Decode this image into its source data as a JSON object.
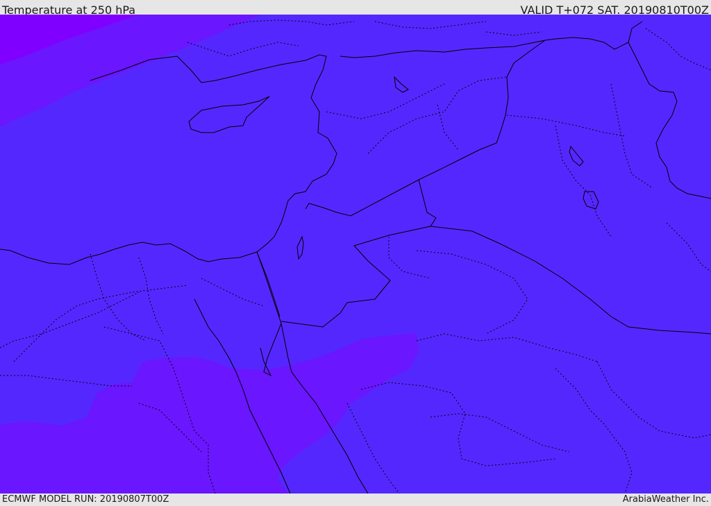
{
  "header": {
    "title": "Temperature at 250 hPa",
    "valid_time": "VALID T+072 SAT. 20190810T00Z"
  },
  "footer": {
    "model_run": "ECMWF MODEL RUN: 20190807T00Z",
    "credit": "ArabiaWeather Inc."
  },
  "map": {
    "region": "Eastern Mediterranean and Middle East",
    "colors": {
      "cold_fill": "#5527ff",
      "cool_fill": "#6a16ff",
      "coldest_fill": "#8000ff",
      "borders": "#000000"
    }
  }
}
